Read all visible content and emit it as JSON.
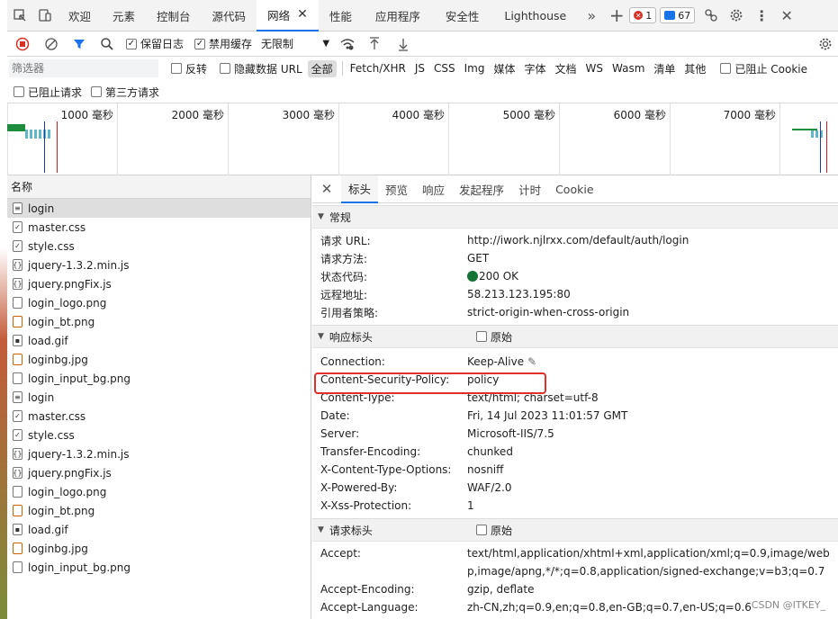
{
  "tabs": [
    {
      "label": "欢迎"
    },
    {
      "label": "元素"
    },
    {
      "label": "控制台"
    },
    {
      "label": "源代码"
    },
    {
      "label": "网络"
    },
    {
      "label": "性能"
    },
    {
      "label": "应用程序"
    },
    {
      "label": "安全性"
    },
    {
      "label": "Lighthouse"
    }
  ],
  "badges": {
    "errors": "1",
    "messages": "67"
  },
  "toolbar": {
    "preserve_log": "保留日志",
    "disable_cache": "禁用缓存",
    "throttle": "无限制"
  },
  "filter": {
    "placeholder": "筛选器",
    "invert": "反转",
    "hide_data_urls": "隐藏数据 URL",
    "types": [
      "全部",
      "Fetch/XHR",
      "JS",
      "CSS",
      "Img",
      "媒体",
      "字体",
      "文档",
      "WS",
      "Wasm",
      "清单",
      "其他"
    ],
    "blocked_cookies": "已阻止 Cookie",
    "blocked_requests": "已阻止请求",
    "third_party": "第三方请求"
  },
  "timeline": {
    "ticks": [
      "1000  毫秒",
      "2000  毫秒",
      "3000  毫秒",
      "4000  毫秒",
      "5000  毫秒",
      "6000  毫秒",
      "7000  毫秒"
    ]
  },
  "requests": {
    "header": "名称",
    "items": [
      "login",
      "master.css",
      "style.css",
      "jquery-1.3.2.min.js",
      "jquery.pngFix.js",
      "login_logo.png",
      "login_bt.png",
      "load.gif",
      "loginbg.jpg",
      "login_input_bg.png",
      "login",
      "master.css",
      "style.css",
      "jquery-1.3.2.min.js",
      "jquery.pngFix.js",
      "login_logo.png",
      "login_bt.png",
      "load.gif",
      "loginbg.jpg",
      "login_input_bg.png"
    ]
  },
  "detail": {
    "tabs": [
      "标头",
      "预览",
      "响应",
      "发起程序",
      "计时",
      "Cookie"
    ],
    "general": {
      "title": "常规",
      "rows": [
        {
          "k": "请求 URL:",
          "v": "http://iwork.njlrxx.com/default/auth/login"
        },
        {
          "k": "请求方法:",
          "v": "GET"
        },
        {
          "k": "状态代码:",
          "v": "200 OK"
        },
        {
          "k": "远程地址:",
          "v": "58.213.123.195:80"
        },
        {
          "k": "引用者策略:",
          "v": "strict-origin-when-cross-origin"
        }
      ]
    },
    "response_headers": {
      "title": "响应标头",
      "raw": "原始",
      "rows": [
        {
          "k": "Connection:",
          "v": "Keep-Alive"
        },
        {
          "k": "Content-Security-Policy:",
          "v": "policy"
        },
        {
          "k": "Content-Type:",
          "v": "text/html; charset=utf-8"
        },
        {
          "k": "Date:",
          "v": "Fri, 14 Jul 2023 11:01:57 GMT"
        },
        {
          "k": "Server:",
          "v": "Microsoft-IIS/7.5"
        },
        {
          "k": "Transfer-Encoding:",
          "v": "chunked"
        },
        {
          "k": "X-Content-Type-Options:",
          "v": "nosniff"
        },
        {
          "k": "X-Powered-By:",
          "v": "WAF/2.0"
        },
        {
          "k": "X-Xss-Protection:",
          "v": "1"
        }
      ]
    },
    "request_headers": {
      "title": "请求标头",
      "raw": "原始",
      "rows": [
        {
          "k": "Accept:",
          "v": "text/html,application/xhtml+xml,application/xml;q=0.9,image/webp,image/apng,*/*;q=0.8,application/signed-exchange;v=b3;q=0.7"
        },
        {
          "k": "Accept-Encoding:",
          "v": "gzip, deflate"
        },
        {
          "k": "Accept-Language:",
          "v": "zh-CN,zh;q=0.9,en;q=0.8,en-GB;q=0.7,en-US;q=0.6"
        }
      ]
    }
  },
  "watermark": "CSDN @ITKEY_"
}
